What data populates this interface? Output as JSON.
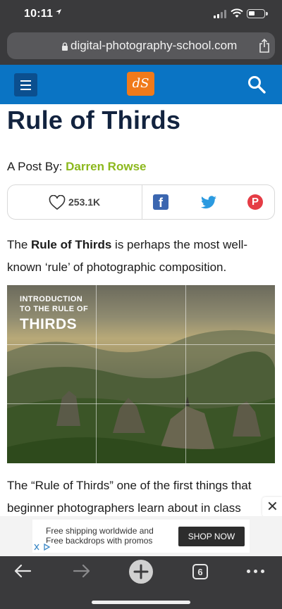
{
  "status_bar": {
    "time": "10:11"
  },
  "browser": {
    "url": "digital-photography-school.com",
    "tab_count": "6"
  },
  "site": {
    "logo_text": "dS",
    "brand_color": "#0a74c4",
    "logo_color": "#f07a1a"
  },
  "article": {
    "title": "Rule of Thirds",
    "byline_prefix": "A Post By: ",
    "author": "Darren Rowse",
    "likes": "253.1K",
    "p1_pre": "The ",
    "p1_bold": "Rule of Thirds",
    "p1_post": " is perhaps the most well-known ‘rule’ of photographic composition.",
    "image_line1": "INTRODUCTION",
    "image_line2": "TO THE RULE OF",
    "image_line3": "THIRDS",
    "p2": "The “Rule of Thirds” one of the first things that beginner photographers learn about in class"
  },
  "ad": {
    "text": "Free shipping worldwide and Free backdrops with promos",
    "button": "SHOP NOW",
    "close": "✕"
  },
  "icons": {
    "share": "share-icon",
    "facebook_letter": "f",
    "pinterest_letter": "P"
  }
}
